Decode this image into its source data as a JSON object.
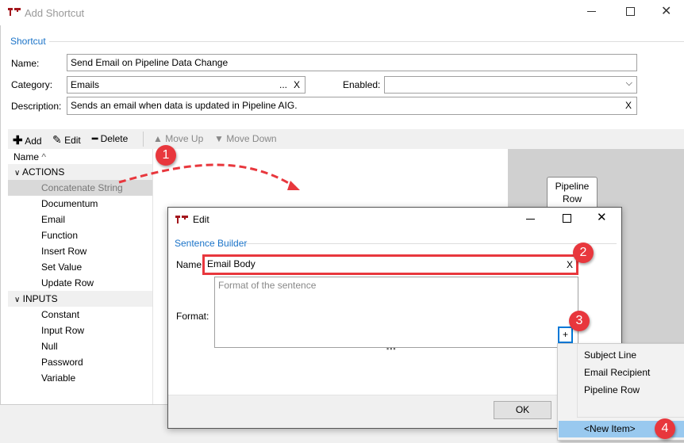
{
  "window": {
    "title": "Add Shortcut",
    "icon": "app-logo-icon"
  },
  "shortcut": {
    "group_label": "Shortcut",
    "name_label": "Name:",
    "name_value": "Send Email on Pipeline Data Change",
    "category_label": "Category:",
    "category_value": "Emails",
    "category_browse": "...",
    "category_clear": "X",
    "enabled_label": "Enabled:",
    "enabled_value": "",
    "description_label": "Description:",
    "description_value": "Sends an email when data is updated in Pipeline AIG.",
    "description_clear": "X"
  },
  "toolbar": {
    "add": "Add",
    "edit": "Edit",
    "delete": "Delete",
    "move_up": "Move Up",
    "move_down": "Move Down"
  },
  "tree": {
    "header": "Name",
    "sort": "^",
    "groups": [
      {
        "label": "ACTIONS",
        "items": [
          "Concatenate String",
          "Documentum",
          "Email",
          "Function",
          "Insert Row",
          "Set Value",
          "Update Row"
        ]
      },
      {
        "label": "INPUTS",
        "items": [
          "Constant",
          "Input Row",
          "Null",
          "Password",
          "Variable"
        ]
      }
    ]
  },
  "canvas": {
    "node_label_1": "Pipeline",
    "node_label_2": "Row"
  },
  "edit_dialog": {
    "title": "Edit",
    "group_label": "Sentence Builder",
    "name_label": "Name:",
    "name_value": "Email Body",
    "name_clear": "X",
    "format_label": "Format:",
    "format_placeholder": "Format of the sentence",
    "plus": "+",
    "dots": "▪▪▪",
    "ok": "OK"
  },
  "menu": {
    "items": [
      "Subject Line",
      "Email Recipient",
      "Pipeline Row"
    ],
    "new_item": "<New Item>"
  },
  "badges": [
    "1",
    "2",
    "3",
    "4"
  ],
  "colors": {
    "accent": "#0078d7",
    "badge": "#e8373d",
    "highlight": "#99c9ef",
    "group_label": "#1a73c8"
  }
}
